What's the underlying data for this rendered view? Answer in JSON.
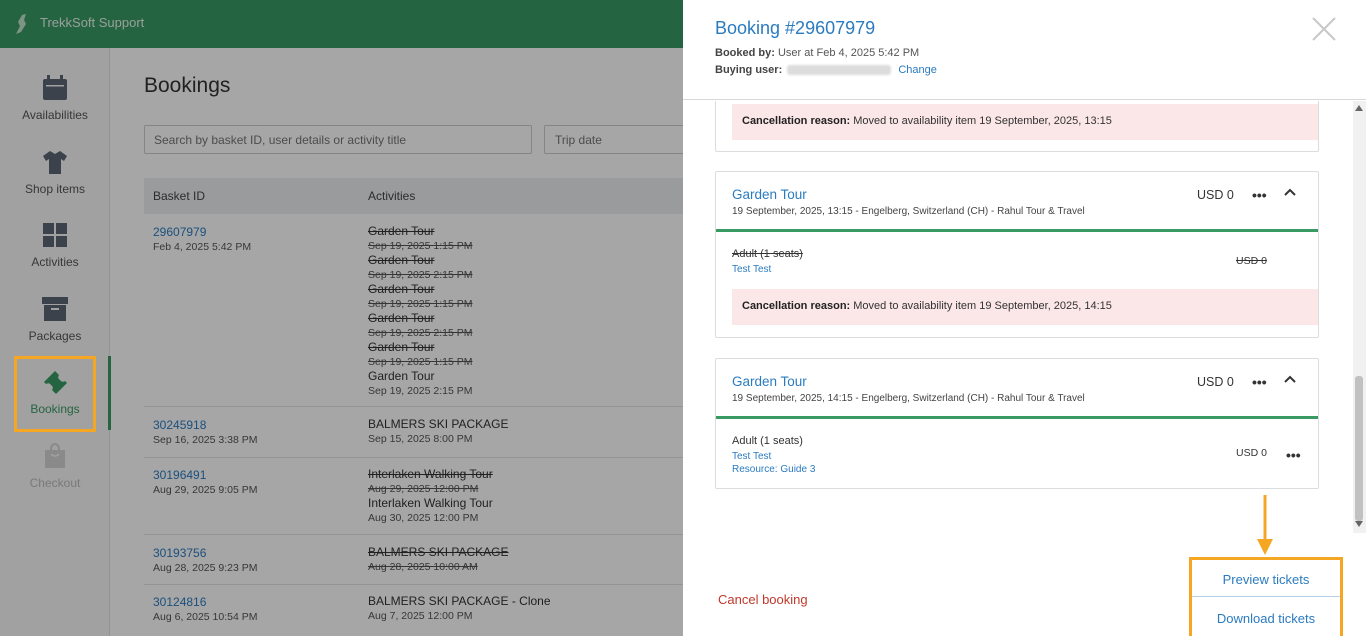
{
  "app": {
    "title": "TrekkSoft Support"
  },
  "sidebar": {
    "items": [
      {
        "label": "Availabilities",
        "icon": "calendar-icon"
      },
      {
        "label": "Shop items",
        "icon": "shirt-icon"
      },
      {
        "label": "Activities",
        "icon": "grid-icon"
      },
      {
        "label": "Packages",
        "icon": "box-icon"
      },
      {
        "label": "Bookings",
        "icon": "ticket-icon",
        "active": true
      },
      {
        "label": "Checkout",
        "icon": "bag-icon",
        "disabled": true
      }
    ]
  },
  "main": {
    "title": "Bookings",
    "search": {
      "placeholder": "Search by basket ID, user details or activity title"
    },
    "trip_date": {
      "placeholder": "Trip date"
    },
    "columns": [
      "Basket ID",
      "Activities"
    ],
    "rows": [
      {
        "id": "29607979",
        "date": "Feb 4, 2025 5:42 PM",
        "activities": [
          {
            "title": "Garden Tour",
            "date": "Sep 19, 2025 1:15 PM",
            "cancelled": true
          },
          {
            "title": "Garden Tour",
            "date": "Sep 19, 2025 2:15 PM",
            "cancelled": true
          },
          {
            "title": "Garden Tour",
            "date": "Sep 19, 2025 1:15 PM",
            "cancelled": true
          },
          {
            "title": "Garden Tour",
            "date": "Sep 19, 2025 2:15 PM",
            "cancelled": true
          },
          {
            "title": "Garden Tour",
            "date": "Sep 19, 2025 1:15 PM",
            "cancelled": true
          },
          {
            "title": "Garden Tour",
            "date": "Sep 19, 2025 2:15 PM",
            "cancelled": false
          }
        ]
      },
      {
        "id": "30245918",
        "date": "Sep 16, 2025 3:38 PM",
        "activities": [
          {
            "title": "BALMERS SKI PACKAGE",
            "date": "Sep 15, 2025 8:00 PM",
            "cancelled": false
          }
        ]
      },
      {
        "id": "30196491",
        "date": "Aug 29, 2025 9:05 PM",
        "activities": [
          {
            "title": "Interlaken Walking Tour",
            "date": "Aug 29, 2025 12:00 PM",
            "cancelled": true
          },
          {
            "title": "Interlaken Walking Tour",
            "date": "Aug 30, 2025 12:00 PM",
            "cancelled": false
          }
        ]
      },
      {
        "id": "30193756",
        "date": "Aug 28, 2025 9:23 PM",
        "activities": [
          {
            "title": "BALMERS SKI PACKAGE",
            "date": "Aug 28, 2025 10:00 AM",
            "cancelled": true
          }
        ]
      },
      {
        "id": "30124816",
        "date": "Aug 6, 2025 10:54 PM",
        "activities": [
          {
            "title": "BALMERS SKI PACKAGE - Clone",
            "date": "Aug 7, 2025 12:00 PM",
            "cancelled": false
          }
        ]
      }
    ]
  },
  "panel": {
    "title": "Booking #29607979",
    "booked_by_label": "Booked by:",
    "booked_by_value": "User at Feb 4, 2025 5:42 PM",
    "buying_user_label": "Buying user:",
    "change_label": "Change",
    "top_cancellation": {
      "label": "Cancellation reason:",
      "text": "Moved to availability item 19 September, 2025, 13:15"
    },
    "cards": [
      {
        "title": "Garden Tour",
        "subtitle": "19 September, 2025, 13:15 - Engelberg, Switzerland (CH) - Rahul Tour & Travel",
        "price": "USD 0",
        "line_name": "Adult (1 seats)",
        "line_customer": "Test Test",
        "line_price": "USD 0",
        "cancelled": true,
        "cancel_label": "Cancellation reason:",
        "cancel_text": "Moved to availability item 19 September, 2025, 14:15"
      },
      {
        "title": "Garden Tour",
        "subtitle": "19 September, 2025, 14:15 - Engelberg, Switzerland (CH) - Rahul Tour & Travel",
        "price": "USD 0",
        "line_name": "Adult (1 seats)",
        "line_customer": "Test Test",
        "line_resource": "Resource: Guide 3",
        "line_price": "USD 0",
        "cancelled": false
      }
    ],
    "cancel_booking": "Cancel booking",
    "preview_tickets": "Preview tickets",
    "download_tickets": "Download tickets"
  },
  "colors": {
    "brand_green": "#3a9a63",
    "link_blue": "#2b7bc0",
    "highlight_orange": "#f5a623",
    "cancel_red": "#c0392b",
    "cancel_bg": "#fbe7e7"
  }
}
